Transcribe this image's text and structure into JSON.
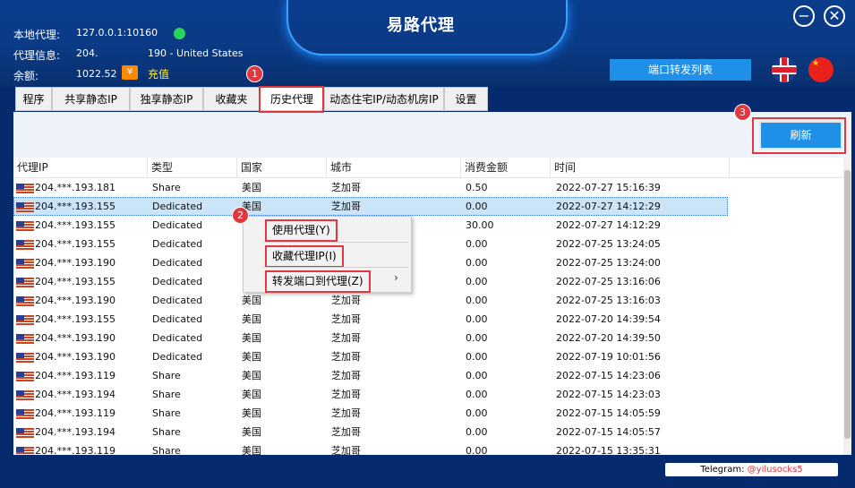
{
  "app": {
    "title": "易路代理"
  },
  "info": {
    "local_label": "本地代理:",
    "local_value": "127.0.0.1:10160",
    "proxy_label": "代理信息:",
    "proxy_value_prefix": "204.",
    "proxy_value_suffix": "190 - United States",
    "balance_label": "余额:",
    "balance_value": "1022.52",
    "recharge_label": "充值",
    "recharge_icon": "¥"
  },
  "header": {
    "port_forward_label": "端口转发列表",
    "lang_en": "english-flag",
    "lang_cn": "china-flag"
  },
  "tabs": [
    {
      "label": "程序"
    },
    {
      "label": "共享静态IP"
    },
    {
      "label": "独享静态IP"
    },
    {
      "label": "收藏夹"
    },
    {
      "label": "历史代理"
    },
    {
      "label": "动态住宅IP/动态机房IP"
    },
    {
      "label": "设置"
    }
  ],
  "toolbar": {
    "refresh_label": "刷新"
  },
  "table": {
    "columns": [
      "代理IP",
      "类型",
      "国家",
      "城市",
      "消费金额",
      "时间"
    ],
    "rows": [
      {
        "ip": "204.***.193.181",
        "type": "Share",
        "country": "美国",
        "city": "芝加哥",
        "amount": "0.50",
        "time": "2022-07-27 15:16:39"
      },
      {
        "ip": "204.***.193.155",
        "type": "Dedicated",
        "country": "美国",
        "city": "芝加哥",
        "amount": "0.00",
        "time": "2022-07-27 14:12:29"
      },
      {
        "ip": "204.***.193.155",
        "type": "Dedicated",
        "country": "",
        "city": "",
        "amount": "30.00",
        "time": "2022-07-27 14:12:29"
      },
      {
        "ip": "204.***.193.155",
        "type": "Dedicated",
        "country": "",
        "city": "",
        "amount": "0.00",
        "time": "2022-07-25 13:24:05"
      },
      {
        "ip": "204.***.193.190",
        "type": "Dedicated",
        "country": "",
        "city": "",
        "amount": "0.00",
        "time": "2022-07-25 13:24:00"
      },
      {
        "ip": "204.***.193.155",
        "type": "Dedicated",
        "country": "",
        "city": "",
        "amount": "0.00",
        "time": "2022-07-25 13:16:06"
      },
      {
        "ip": "204.***.193.190",
        "type": "Dedicated",
        "country": "美国",
        "city": "芝加哥",
        "amount": "0.00",
        "time": "2022-07-25 13:16:03"
      },
      {
        "ip": "204.***.193.155",
        "type": "Dedicated",
        "country": "美国",
        "city": "芝加哥",
        "amount": "0.00",
        "time": "2022-07-20 14:39:54"
      },
      {
        "ip": "204.***.193.190",
        "type": "Dedicated",
        "country": "美国",
        "city": "芝加哥",
        "amount": "0.00",
        "time": "2022-07-20 14:39:50"
      },
      {
        "ip": "204.***.193.190",
        "type": "Dedicated",
        "country": "美国",
        "city": "芝加哥",
        "amount": "0.00",
        "time": "2022-07-19 10:01:56"
      },
      {
        "ip": "204.***.193.119",
        "type": "Share",
        "country": "美国",
        "city": "芝加哥",
        "amount": "0.00",
        "time": "2022-07-15 14:23:06"
      },
      {
        "ip": "204.***.193.194",
        "type": "Share",
        "country": "美国",
        "city": "芝加哥",
        "amount": "0.00",
        "time": "2022-07-15 14:23:03"
      },
      {
        "ip": "204.***.193.119",
        "type": "Share",
        "country": "美国",
        "city": "芝加哥",
        "amount": "0.00",
        "time": "2022-07-15 14:05:59"
      },
      {
        "ip": "204.***.193.194",
        "type": "Share",
        "country": "美国",
        "city": "芝加哥",
        "amount": "0.00",
        "time": "2022-07-15 14:05:57"
      },
      {
        "ip": "204.***.193.119",
        "type": "Share",
        "country": "美国",
        "city": "芝加哥",
        "amount": "0.00",
        "time": "2022-07-15 13:35:31"
      }
    ]
  },
  "context_menu": {
    "items": [
      {
        "label": "使用代理(Y)"
      },
      {
        "label": "收藏代理IP(I)"
      },
      {
        "label": "转发端口到代理(Z)"
      }
    ],
    "submenu_arrow": "›"
  },
  "annotations": [
    "1",
    "2",
    "3"
  ],
  "footer": {
    "telegram_label": "Telegram: ",
    "telegram_handle": "@yilusocks5"
  },
  "window": {
    "minimize": "−",
    "close": "✕"
  }
}
